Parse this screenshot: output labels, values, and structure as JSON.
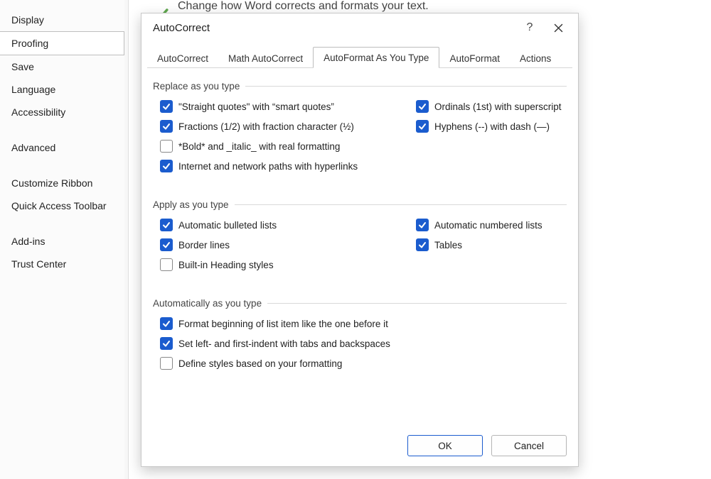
{
  "sidebar": {
    "items": [
      {
        "label": "Display",
        "selected": false,
        "group": 0
      },
      {
        "label": "Proofing",
        "selected": true,
        "group": 0
      },
      {
        "label": "Save",
        "selected": false,
        "group": 0
      },
      {
        "label": "Language",
        "selected": false,
        "group": 0
      },
      {
        "label": "Accessibility",
        "selected": false,
        "group": 0
      },
      {
        "label": "Advanced",
        "selected": false,
        "group": 1
      },
      {
        "label": "Customize Ribbon",
        "selected": false,
        "group": 2
      },
      {
        "label": "Quick Access Toolbar",
        "selected": false,
        "group": 2
      },
      {
        "label": "Add-ins",
        "selected": false,
        "group": 3
      },
      {
        "label": "Trust Center",
        "selected": false,
        "group": 3
      }
    ]
  },
  "back_hint": "Change how Word corrects and formats your text.",
  "dialog": {
    "title": "AutoCorrect",
    "tabs": [
      {
        "label": "AutoCorrect",
        "selected": false
      },
      {
        "label": "Math AutoCorrect",
        "selected": false
      },
      {
        "label": "AutoFormat As You Type",
        "selected": true
      },
      {
        "label": "AutoFormat",
        "selected": false
      },
      {
        "label": "Actions",
        "selected": false
      }
    ],
    "groups": [
      {
        "title": "Replace as you type",
        "options": [
          {
            "label": "\"Straight quotes\" with “smart quotes”",
            "checked": true,
            "col": 0
          },
          {
            "label": "Ordinals (1st) with superscript",
            "checked": true,
            "col": 1
          },
          {
            "label": "Fractions (1/2) with fraction character (½)",
            "checked": true,
            "col": 0
          },
          {
            "label": "Hyphens (--) with dash (—)",
            "checked": true,
            "col": 1
          },
          {
            "label": "*Bold* and _italic_ with real formatting",
            "checked": false,
            "col": 0
          },
          {
            "label": "Internet and network paths with hyperlinks",
            "checked": true,
            "col": 0
          }
        ]
      },
      {
        "title": "Apply as you type",
        "options": [
          {
            "label": "Automatic bulleted lists",
            "checked": true,
            "col": 0
          },
          {
            "label": "Automatic numbered lists",
            "checked": true,
            "col": 1
          },
          {
            "label": "Border lines",
            "checked": true,
            "col": 0
          },
          {
            "label": "Tables",
            "checked": true,
            "col": 1
          },
          {
            "label": "Built-in Heading styles",
            "checked": false,
            "col": 0
          }
        ]
      },
      {
        "title": "Automatically as you type",
        "options": [
          {
            "label": "Format beginning of list item like the one before it",
            "checked": true,
            "col": 0
          },
          {
            "label": "Set left- and first-indent with tabs and backspaces",
            "checked": true,
            "col": 0
          },
          {
            "label": "Define styles based on your formatting",
            "checked": false,
            "col": 0
          }
        ]
      }
    ],
    "buttons": {
      "ok": "OK",
      "cancel": "Cancel"
    }
  }
}
